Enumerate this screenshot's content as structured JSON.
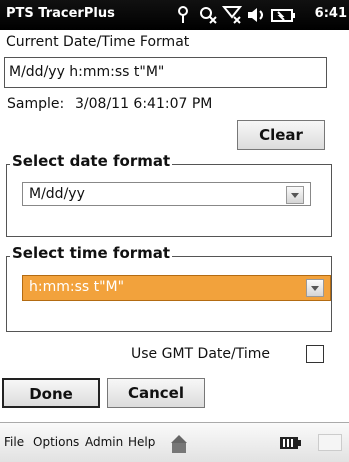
{
  "titlebar": {
    "title": "PTS TracerPlus",
    "time": "6:41"
  },
  "current_format": {
    "label": "Current Date/Time Format",
    "value": "M/dd/yy h:mm:ss t\"M\""
  },
  "sample": {
    "label": "Sample:",
    "value": "3/08/11 6:41:07 PM"
  },
  "buttons": {
    "clear": "Clear",
    "done": "Done",
    "cancel": "Cancel"
  },
  "date_group": {
    "legend": "Select date format",
    "selected": "M/dd/yy"
  },
  "time_group": {
    "legend": "Select time format",
    "selected": "h:mm:ss t\"M\""
  },
  "gmt": {
    "label": "Use GMT Date/Time",
    "checked": false
  },
  "menu": {
    "file": "File",
    "options": "Options",
    "admin": "Admin",
    "help": "Help"
  },
  "colors": {
    "highlight": "#f2a23c",
    "titlebar": "#000000"
  },
  "icons": [
    "antenna-icon",
    "sync-icon",
    "signal-off-icon",
    "speaker-icon",
    "battery-charging-icon",
    "keyboard-icon",
    "battery-icon"
  ]
}
